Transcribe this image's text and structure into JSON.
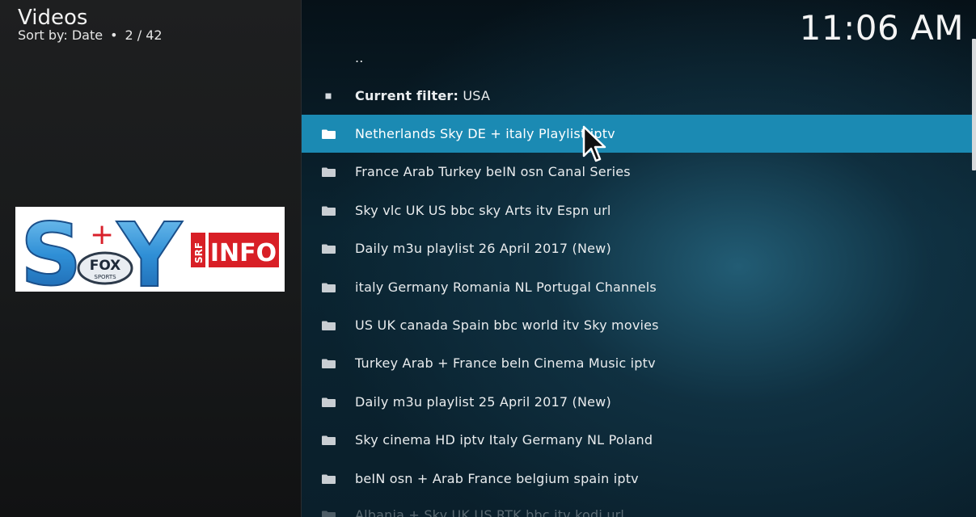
{
  "header": {
    "title": "Videos",
    "sort_label": "Sort by: Date",
    "separator": "•",
    "position": "2 / 42"
  },
  "clock": "11:06 AM",
  "thumbnail": {
    "logo_letters": [
      "S",
      "+",
      "Y"
    ],
    "badge_text": "FOX",
    "badge_subtext": "SPORTS",
    "brand_text": "SRF",
    "brand_word": "INFO"
  },
  "list": {
    "parent_item": "..",
    "filter_label": "Current filter:",
    "filter_value": "USA",
    "items": [
      "Netherlands Sky DE + italy Playlist iptv",
      "France Arab Turkey beIN osn Canal Series",
      "Sky vlc UK US bbc sky Arts itv Espn url",
      "Daily m3u playlist 26 April 2017 (New)",
      "italy Germany Romania NL Portugal Channels",
      "US UK canada Spain bbc world itv Sky movies",
      "Turkey Arab + France beln Cinema Music iptv",
      "Daily m3u playlist 25 April 2017 (New)",
      "Sky cinema HD iptv Italy Germany NL Poland",
      "beIN osn + Arab France belgium spain iptv",
      "Albania + Sky UK US RTK bbc itv kodi url"
    ],
    "selected_index": 0
  },
  "colors": {
    "selection": "#1b8ab3",
    "left_bg": "#1e1f20",
    "right_bg": "#0a2431"
  },
  "icons": {
    "folder": "folder-icon",
    "filter": "filter-square-icon",
    "cursor": "mouse-pointer-icon"
  }
}
